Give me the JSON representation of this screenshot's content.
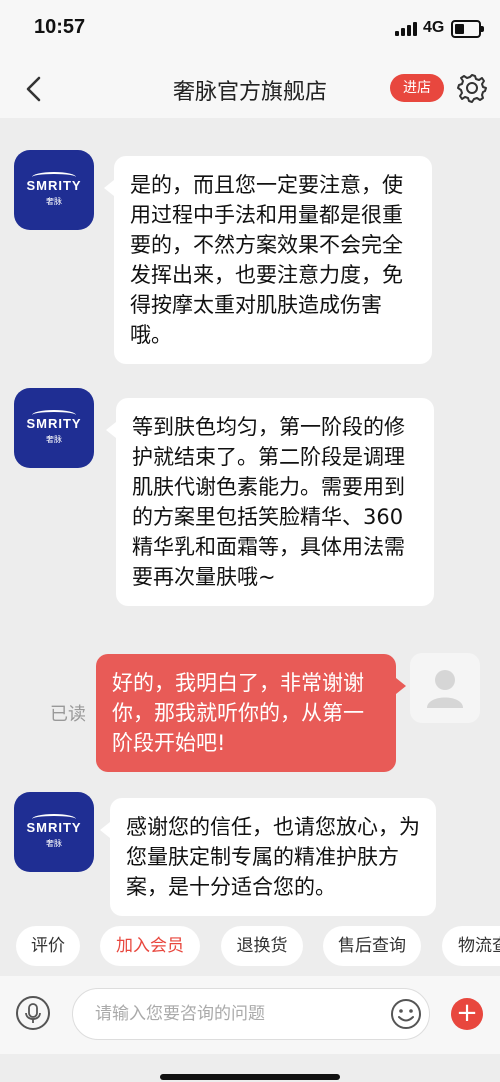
{
  "status_bar": {
    "time": "10:57",
    "network": "4G"
  },
  "nav": {
    "title": "奢脉官方旗舰店",
    "enter_store": "进店"
  },
  "store_avatar": {
    "brand": "SMRITY",
    "brand_sub": "奢脉"
  },
  "messages": [
    {
      "from": "store",
      "text": "是的，而且您一定要注意，使用过程中手法和用量都是很重要的，不然方案效果不会完全发挥出来，也要注意力度，免得按摩太重对肌肤造成伤害哦。"
    },
    {
      "from": "store",
      "text": "等到肤色均匀，第一阶段的修护就结束了。第二阶段是调理肌肤代谢色素能力。需要用到的方案里包括笑脸精华、360精华乳和面霜等，具体用法需要再次量肤哦~"
    },
    {
      "from": "me",
      "text": "好的，我明白了，非常谢谢你，那我就听你的，从第一阶段开始吧!",
      "status": "已读"
    },
    {
      "from": "store",
      "text": "感谢您的信任，也请您放心，为您量肤定制专属的精准护肤方案，是十分适合您的。"
    }
  ],
  "quick_replies": [
    "评价",
    "加入会员",
    "退换货",
    "售后查询",
    "物流查"
  ],
  "input": {
    "placeholder": "请输入您要咨询的问题"
  },
  "colors": {
    "accent": "#e8473e",
    "my_bubble": "#e85b57",
    "brand": "#1f2e93"
  }
}
